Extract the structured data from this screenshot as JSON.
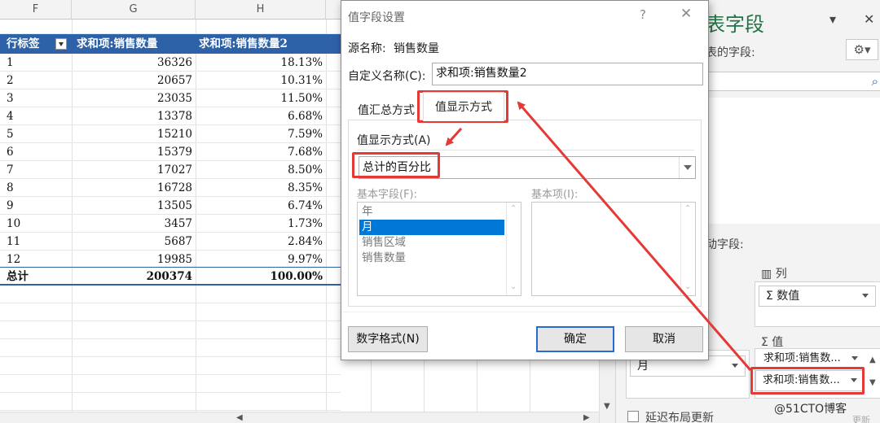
{
  "sheet": {
    "columns": [
      "F",
      "G",
      "H"
    ],
    "pivot_headers": [
      "行标签",
      "求和项:销售数量",
      "求和项:销售数量2"
    ],
    "rows": [
      {
        "label": "1",
        "qty": "36326",
        "pct": "18.13%"
      },
      {
        "label": "2",
        "qty": "20657",
        "pct": "10.31%"
      },
      {
        "label": "3",
        "qty": "23035",
        "pct": "11.50%"
      },
      {
        "label": "4",
        "qty": "13378",
        "pct": "6.68%"
      },
      {
        "label": "5",
        "qty": "15210",
        "pct": "7.59%"
      },
      {
        "label": "6",
        "qty": "15379",
        "pct": "7.68%"
      },
      {
        "label": "7",
        "qty": "17027",
        "pct": "8.50%"
      },
      {
        "label": "8",
        "qty": "16728",
        "pct": "8.35%"
      },
      {
        "label": "9",
        "qty": "13505",
        "pct": "6.74%"
      },
      {
        "label": "10",
        "qty": "3457",
        "pct": "1.73%"
      },
      {
        "label": "11",
        "qty": "5687",
        "pct": "2.84%"
      },
      {
        "label": "12",
        "qty": "19985",
        "pct": "9.97%"
      }
    ],
    "total": {
      "label": "总计",
      "qty": "200374",
      "pct": "100.00%"
    }
  },
  "panel": {
    "title": "表字段",
    "subtitle": "表的字段:",
    "drag_label": "动字段:",
    "columns_label": "列",
    "columns_field": "数值",
    "values_label": "值",
    "rows_field": "月",
    "values_field_1": "求和项:销售数...",
    "values_field_2": "求和项:销售数...",
    "defer_label": "延迟布局更新",
    "update_label": "更新"
  },
  "dialog": {
    "title": "值字段设置",
    "help": "?",
    "close": "✕",
    "source_label": "源名称:",
    "source_value": "销售数量",
    "custom_name_label": "自定义名称(C):",
    "custom_name_value": "求和项:销售数量2",
    "tab_summarize": "值汇总方式",
    "tab_show_as": "值显示方式",
    "show_as_label": "值显示方式(A)",
    "show_as_value": "总计的百分比",
    "base_field_label": "基本字段(F):",
    "base_item_label": "基本项(I):",
    "base_fields": [
      "年",
      "月",
      "销售区域",
      "销售数量"
    ],
    "number_format_btn": "数字格式(N)",
    "ok_btn": "确定",
    "cancel_btn": "取消"
  },
  "watermark": "@51CTO博客",
  "colors": {
    "accent": "#2e62a8",
    "annotation": "#e53935",
    "title_green": "#217346",
    "selection": "#0078d7"
  }
}
